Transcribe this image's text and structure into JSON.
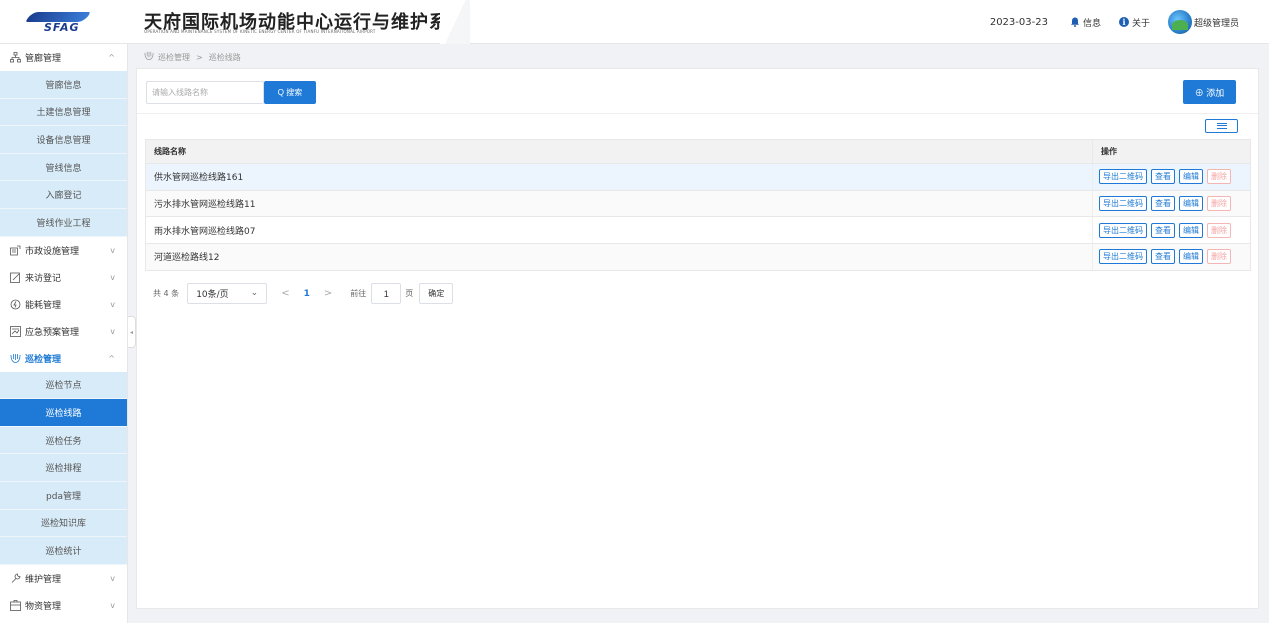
{
  "header": {
    "logo_text": "SFAG",
    "title": "天府国际机场动能中心运行与维护系统",
    "subtitle": "OPERATION AND MAINTENANCE SYSTEM OF KINETIC ENERGY CENTER OF TIANFU INTERNATIONAL AIRPORT",
    "date": "2023-03-23",
    "info_label": "信息",
    "about_label": "关于",
    "user_name": "超级管理员"
  },
  "sidebar": {
    "groups": [
      {
        "label": "管廊管理",
        "icon": "org-chart-icon",
        "arrow": "^",
        "items": [
          "管廊信息",
          "土建信息管理",
          "设备信息管理",
          "管线信息",
          "入廊登记",
          "管线作业工程"
        ]
      },
      {
        "label": "市政设施管理",
        "icon": "facility-icon",
        "arrow": "v"
      },
      {
        "label": "来访登记",
        "icon": "edit-icon",
        "arrow": "v"
      },
      {
        "label": "能耗管理",
        "icon": "energy-icon",
        "arrow": "v"
      },
      {
        "label": "应急预案管理",
        "icon": "plan-icon",
        "arrow": "v"
      },
      {
        "label": "巡检管理",
        "icon": "patrol-icon",
        "arrow": "^",
        "items": [
          "巡检节点",
          "巡检线路",
          "巡检任务",
          "巡检排程",
          "pda管理",
          "巡检知识库",
          "巡检统计"
        ]
      },
      {
        "label": "维护管理",
        "icon": "wrench-icon",
        "arrow": "v"
      },
      {
        "label": "物资管理",
        "icon": "box-icon",
        "arrow": "v"
      }
    ],
    "active_item": "巡检线路"
  },
  "breadcrumb": {
    "parent": "巡检管理",
    "sep": ">",
    "current": "巡检线路"
  },
  "toolbar": {
    "search_placeholder": "请输入线路名称",
    "search_label": "Q 搜索",
    "add_label": "⊕ 添加"
  },
  "table": {
    "headers": [
      "线路名称",
      "操作"
    ],
    "rows": [
      "供水管网巡检线路161",
      "污水排水管网巡检线路11",
      "雨水排水管网巡检线路07",
      "河道巡检路线12"
    ],
    "actions": [
      "导出二维码",
      "查看",
      "编辑",
      "删除"
    ]
  },
  "pagination": {
    "total": "共 4 条",
    "page_size": "10条/页",
    "prev": "<",
    "current_page": "1",
    "next": ">",
    "goto_label": "前往",
    "goto_value": "1",
    "page_unit": "页",
    "confirm": "确定"
  },
  "colors": {
    "primary": "#1e7ad6",
    "submenu_bg": "#d8ebf8",
    "danger": "#f5a3a3"
  }
}
